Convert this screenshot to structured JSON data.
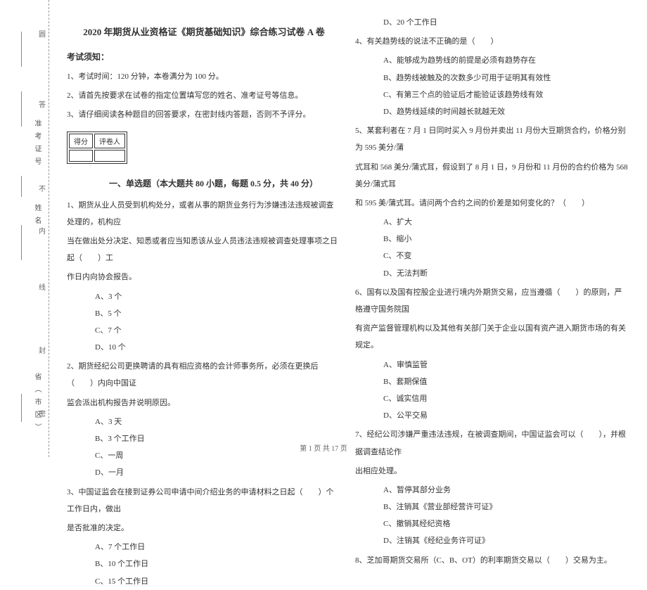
{
  "binding": {
    "label_id": "准考证号",
    "label_name": "姓名",
    "label_district": "省（市区）",
    "seal_chars": [
      "圆",
      "答",
      "准",
      "不",
      "内",
      "线",
      "封",
      "密"
    ]
  },
  "title": "2020 年期货从业资格证《期货基础知识》综合练习试卷 A 卷",
  "notice_title": "考试须知：",
  "notices": [
    "1、考试时间：120 分钟，本卷满分为 100 分。",
    "2、请首先按要求在试卷的指定位置填写您的姓名、准考证号等信息。",
    "3、请仔细阅读各种题目的回答要求，在密封线内答题，否则不予评分。"
  ],
  "score_table": {
    "h1": "得分",
    "h2": "评卷人"
  },
  "part1_title": "一、单选题（本大题共 80 小题，每题 0.5 分，共 40 分）",
  "q1": {
    "stem_l1": "1、期货从业人员受到机构处分，或者从事的期货业务行为涉嫌违法违规被调查处理的，机构应",
    "stem_l2": "当在做出处分决定、知悉或者应当知悉该从业人员违法违规被调查处理事项之日起（　　）工",
    "stem_l3": "作日内向协会报告。",
    "a": "A、3 个",
    "b": "B、5 个",
    "c": "C、7 个",
    "d": "D、10 个"
  },
  "q2": {
    "stem_l1": "2、期货经纪公司更换聘请的具有相应资格的会计师事务所，必须在更换后（　　）内向中国证",
    "stem_l2": "监会派出机构报告并说明原因。",
    "a": "A、3 天",
    "b": "B、3 个工作日",
    "c": "C、一周",
    "d": "D、一月"
  },
  "q3": {
    "stem_l1": "3、中国证监会在接到证券公司申请中间介绍业务的申请材料之日起（　　）个工作日内，做出",
    "stem_l2": "是否批准的决定。",
    "a": "A、7 个工作日",
    "b": "B、10 个工作日",
    "c": "C、15 个工作日",
    "d": "D、20 个工作日"
  },
  "q4": {
    "stem": "4、有关趋势线的说法不正确的是（　　）",
    "a": "A、能够成为趋势线的前提是必须有趋势存在",
    "b": "B、趋势线被触及的次数多少可用于证明其有效性",
    "c": "C、有第三个点的验证后才能验证该趋势线有效",
    "d": "D、趋势线延续的时间越长就越无效"
  },
  "q5": {
    "stem_l1": "5、某套利者在 7 月 1 日同时买入 9 月份并卖出 11 月份大豆期货合约，价格分别为 595 美分/蒲",
    "stem_l2": "式耳和 568 美分/蒲式耳，假设到了 8 月 1 日，9 月份和 11 月份的合约价格为 568 美分/蒲式耳",
    "stem_l3": "和 595 美/蒲式耳。请问两个合约之间的价差是如何变化的？（　　）",
    "a": "A、扩大",
    "b": "B、缩小",
    "c": "C、不变",
    "d": "D、无法判断"
  },
  "q6": {
    "stem_l1": "6、国有以及国有控股企业进行境内外期货交易，应当遵循（　　）的原则，严格遵守国务院国",
    "stem_l2": "有资产监督管理机构以及其他有关部门关于企业以国有资产进入期货市场的有关规定。",
    "a": "A、审慎监管",
    "b": "B、套期保值",
    "c": "C、诚实信用",
    "d": "D、公平交易"
  },
  "q7": {
    "stem_l1": "7、经纪公司涉嫌严重违法违规，在被调查期间，中国证监会可以（　　），并根据调查结论作",
    "stem_l2": "出相应处理。",
    "a": "A、暂停其部分业务",
    "b": "B、注销其《营业部经营许可证》",
    "c": "C、撤销其经纪资格",
    "d": "D、注销其《经纪业务许可证》"
  },
  "q8": {
    "stem": "8、芝加哥期货交易所（C、B、OT）的利率期货交易以（　　）交易为主。"
  },
  "footer": "第 1 页 共 17 页"
}
